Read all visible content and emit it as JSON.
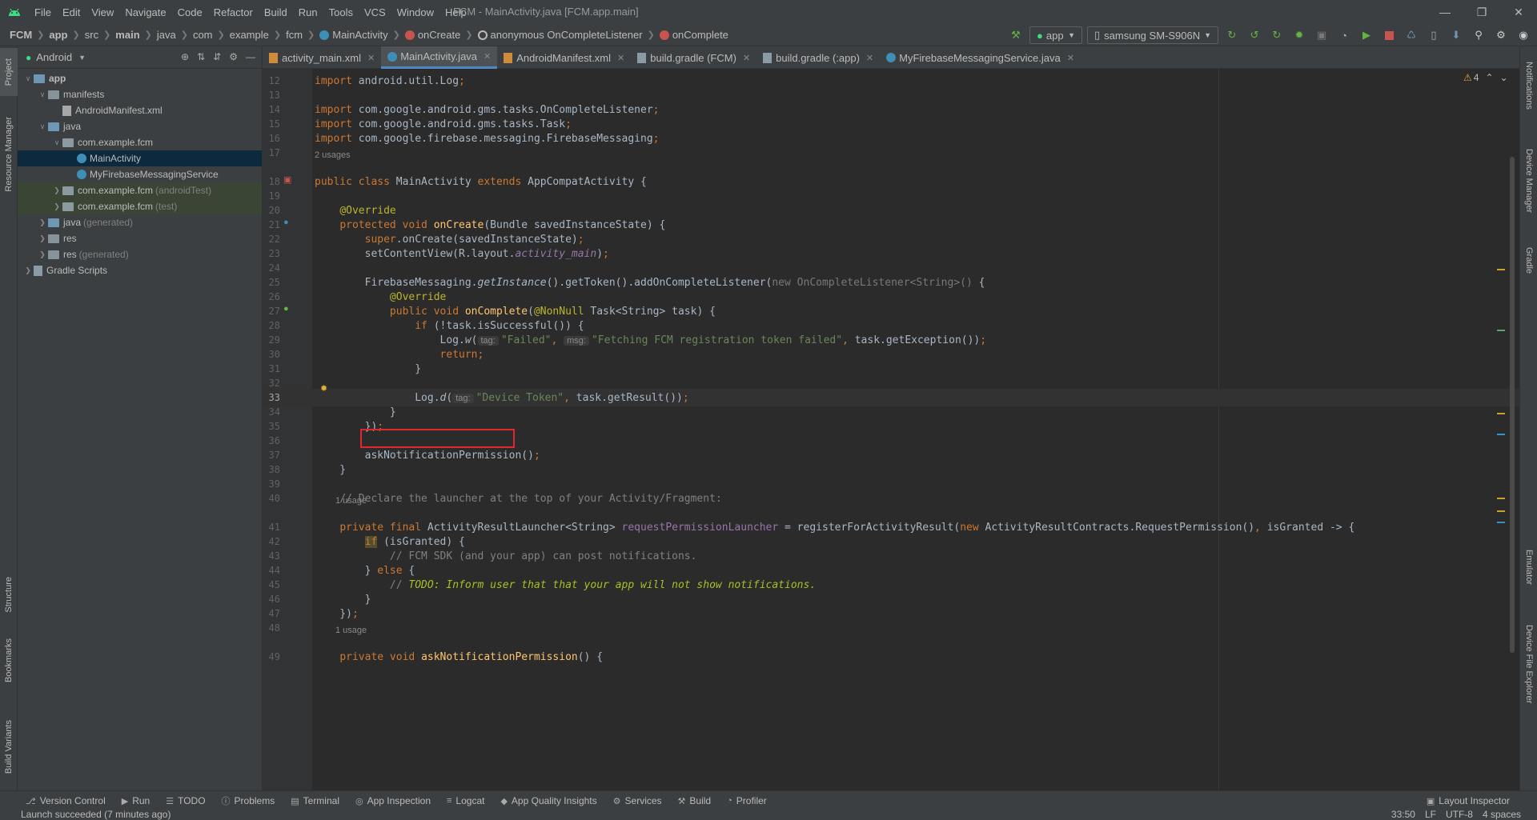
{
  "title_bar": {
    "menu": [
      "File",
      "Edit",
      "View",
      "Navigate",
      "Code",
      "Refactor",
      "Build",
      "Run",
      "Tools",
      "VCS",
      "Window",
      "Help"
    ],
    "window_title": "FCM - MainActivity.java [FCM.app.main]"
  },
  "nav_bar": {
    "breadcrumbs": [
      "FCM",
      "app",
      "src",
      "main",
      "java",
      "com",
      "example",
      "fcm",
      "MainActivity",
      "onCreate",
      "anonymous OnCompleteListener",
      "onComplete"
    ],
    "run_config": "app",
    "device": "samsung SM-S906N"
  },
  "project_panel": {
    "view_mode": "Android",
    "tree": [
      {
        "label": "app",
        "extra": "",
        "indent": 0,
        "expanded": true,
        "kind": "folder-blue",
        "bold": true
      },
      {
        "label": "manifests",
        "extra": "",
        "indent": 1,
        "expanded": true,
        "kind": "folder"
      },
      {
        "label": "AndroidManifest.xml",
        "extra": "",
        "indent": 2,
        "expanded": null,
        "kind": "file"
      },
      {
        "label": "java",
        "extra": "",
        "indent": 1,
        "expanded": true,
        "kind": "folder-blue"
      },
      {
        "label": "com.example.fcm",
        "extra": "",
        "indent": 2,
        "expanded": true,
        "kind": "package"
      },
      {
        "label": "MainActivity",
        "extra": "",
        "indent": 3,
        "expanded": null,
        "kind": "class",
        "selected": true
      },
      {
        "label": "MyFirebaseMessagingService",
        "extra": "",
        "indent": 3,
        "expanded": null,
        "kind": "class"
      },
      {
        "label": "com.example.fcm",
        "extra": "(androidTest)",
        "indent": 2,
        "expanded": false,
        "kind": "package",
        "test": true
      },
      {
        "label": "com.example.fcm",
        "extra": "(test)",
        "indent": 2,
        "expanded": false,
        "kind": "package",
        "test": true
      },
      {
        "label": "java",
        "extra": "(generated)",
        "indent": 1,
        "expanded": false,
        "kind": "folder-blue"
      },
      {
        "label": "res",
        "extra": "",
        "indent": 1,
        "expanded": false,
        "kind": "folder"
      },
      {
        "label": "res",
        "extra": "(generated)",
        "indent": 1,
        "expanded": false,
        "kind": "folder"
      },
      {
        "label": "Gradle Scripts",
        "extra": "",
        "indent": 0,
        "expanded": false,
        "kind": "gradle"
      }
    ]
  },
  "left_strip": [
    "Project",
    "Resource Manager",
    "Structure",
    "Bookmarks",
    "Build Variants"
  ],
  "right_strip": [
    "Notifications",
    "Device Manager",
    "Gradle",
    "Emulator",
    "Device File Explorer"
  ],
  "editor_tabs": [
    {
      "label": "activity_main.xml",
      "active": false
    },
    {
      "label": "MainActivity.java",
      "active": true
    },
    {
      "label": "AndroidManifest.xml",
      "active": false
    },
    {
      "label": "build.gradle (FCM)",
      "active": false
    },
    {
      "label": "build.gradle (:app)",
      "active": false
    },
    {
      "label": "MyFirebaseMessagingService.java",
      "active": false
    }
  ],
  "inspection": {
    "warnings": "4"
  },
  "usages": {
    "u18": "2 usages",
    "u41": "1 usage",
    "u49": "1 usage"
  },
  "code_lines": [
    {
      "n": "12",
      "html": "<span class='kw'>import </span>android.util.Log<span class='kw'>;</span>"
    },
    {
      "n": "13",
      "html": ""
    },
    {
      "n": "14",
      "html": "<span class='kw'>import </span>com.google.android.gms.tasks.OnCompleteListener<span class='kw'>;</span>"
    },
    {
      "n": "15",
      "html": "<span class='kw'>import </span>com.google.android.gms.tasks.Task<span class='kw'>;</span>"
    },
    {
      "n": "16",
      "html": "<span class='kw'>import </span>com.google.firebase.messaging.FirebaseMessaging<span class='kw'>;</span>"
    },
    {
      "n": "17",
      "html": ""
    },
    {
      "n": "18",
      "html": "<span class='kw'>public class </span>MainActivity <span class='kw'>extends </span>AppCompatActivity {"
    },
    {
      "n": "19",
      "html": ""
    },
    {
      "n": "20",
      "html": "    <span class='ann'>@Override</span>"
    },
    {
      "n": "21",
      "html": "    <span class='kw'>protected void </span><span class='fn'>onCreate</span>(Bundle savedInstanceState) {"
    },
    {
      "n": "22",
      "html": "        <span class='kw'>super</span>.onCreate(savedInstanceState)<span class='kw'>;</span>"
    },
    {
      "n": "23",
      "html": "        setContentView(R.layout.<span class='field'>activity_main</span>)<span class='kw'>;</span>"
    },
    {
      "n": "24",
      "html": ""
    },
    {
      "n": "25",
      "html": "        FirebaseMessaging.<span class='it'>getInstance</span>().getToken().addOnCompleteListener(<span class='gray-code'>new OnCompleteListener&lt;String&gt;()</span> {"
    },
    {
      "n": "26",
      "html": "            <span class='ann'>@Override</span>"
    },
    {
      "n": "27",
      "html": "            <span class='kw'>public void </span><span class='fn'>onComplete</span>(<span class='ann'>@NonNull </span>Task&lt;String&gt; task) {"
    },
    {
      "n": "28",
      "html": "                <span class='kw'>if </span>(!task.isSuccessful()) {"
    },
    {
      "n": "29",
      "html": "                    Log.<span class='it'>w</span>(<span class='hint'>tag:</span><span class='str'>\"Failed\"</span><span class='kw'>, </span><span class='hint'>msg:</span><span class='str'>\"Fetching FCM registration token failed\"</span><span class='kw'>, </span>task.getException())<span class='kw'>;</span>"
    },
    {
      "n": "30",
      "html": "                    <span class='kw'>return;</span>"
    },
    {
      "n": "31",
      "html": "                }"
    },
    {
      "n": "32",
      "html": ""
    },
    {
      "n": "33",
      "html": "                Log.<span class='it'>d</span>(<span class='hint'>tag:</span><span class='str'>\"Device Token\"</span><span class='kw'>, </span>task.getResult())<span class='kw'>;</span>"
    },
    {
      "n": "34",
      "html": "            }"
    },
    {
      "n": "35",
      "html": "        })<span class='kw'>;</span>"
    },
    {
      "n": "36",
      "html": ""
    },
    {
      "n": "37",
      "html": "        askNotificationPermission()<span class='kw'>;</span>"
    },
    {
      "n": "38",
      "html": "    }"
    },
    {
      "n": "39",
      "html": ""
    },
    {
      "n": "40",
      "html": "    <span class='cm'>// Declare the launcher at the top of your Activity/Fragment:</span>"
    },
    {
      "n": "41",
      "html": "    <span class='kw'>private final </span>ActivityResultLauncher&lt;String&gt; <span class='field' style='font-style:normal'>requestPermissionLauncher</span> = registerForActivityResult(<span class='kw'>new </span>ActivityResultContracts.RequestPermission()<span class='kw'>, </span>isGranted -&gt; {"
    },
    {
      "n": "42",
      "html": "        <span class='kw' style='background:#524e2f'>if</span> (isGranted) {"
    },
    {
      "n": "43",
      "html": "            <span class='cm'>// FCM SDK (and your app) can post notifications.</span>"
    },
    {
      "n": "44",
      "html": "        } <span class='kw'>else </span>{"
    },
    {
      "n": "45",
      "html": "            <span class='cm'>// </span><span class='todo'>TODO: Inform user that that your app will not show notifications.</span>"
    },
    {
      "n": "46",
      "html": "        }"
    },
    {
      "n": "47",
      "html": "    })<span class='kw'>;</span>"
    },
    {
      "n": "48",
      "html": ""
    },
    {
      "n": "49",
      "html": "    <span class='kw'>private void </span><span class='fn'>askNotificationPermission</span>() {"
    }
  ],
  "bottom_tools": [
    {
      "label": "Version Control",
      "icon": "branch-icon"
    },
    {
      "label": "Run",
      "icon": "play-icon"
    },
    {
      "label": "TODO",
      "icon": "list-icon"
    },
    {
      "label": "Problems",
      "icon": "info-icon"
    },
    {
      "label": "Terminal",
      "icon": "terminal-icon"
    },
    {
      "label": "App Inspection",
      "icon": "inspect-icon"
    },
    {
      "label": "Logcat",
      "icon": "logcat-icon"
    },
    {
      "label": "App Quality Insights",
      "icon": "quality-icon"
    },
    {
      "label": "Services",
      "icon": "services-icon"
    },
    {
      "label": "Build",
      "icon": "hammer-icon"
    },
    {
      "label": "Profiler",
      "icon": "profiler-icon"
    }
  ],
  "layout_inspector": "Layout Inspector",
  "status": {
    "message": "Launch succeeded (7 minutes ago)",
    "position": "33:50",
    "line_sep": "LF",
    "encoding": "UTF-8",
    "indent": "4 spaces"
  }
}
